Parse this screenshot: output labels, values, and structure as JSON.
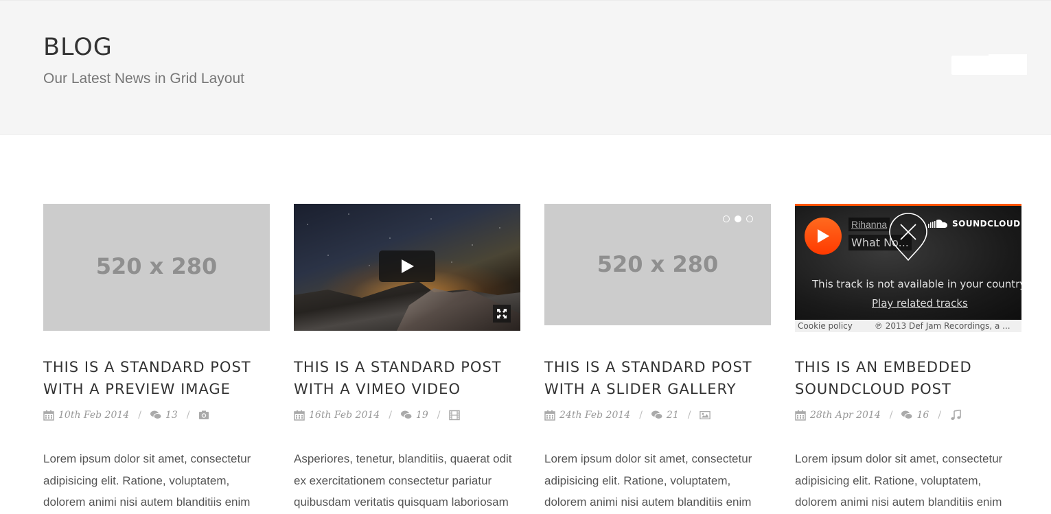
{
  "header": {
    "title": "BLOG",
    "subtitle": "Our Latest News in Grid Layout"
  },
  "posts": [
    {
      "media_type": "image",
      "placeholder": "520 x 280",
      "title_line1": "THIS IS A STANDARD POST",
      "title_line2": "WITH A PREVIEW IMAGE",
      "date": "10th Feb 2014",
      "comments": "13",
      "format_icon": "camera-icon",
      "excerpt": [
        "Lorem ipsum dolor sit amet, consectetur",
        "adipisicing elit. Ratione, voluptatem,",
        "dolorem animi nisi autem blanditiis enim"
      ]
    },
    {
      "media_type": "video",
      "title_line1": "THIS IS A STANDARD POST",
      "title_line2": "WITH A VIMEO VIDEO",
      "date": "16th Feb 2014",
      "comments": "19",
      "format_icon": "film-icon",
      "excerpt": [
        "Asperiores, tenetur, blanditiis, quaerat odit",
        "ex exercitationem consectetur pariatur",
        "quibusdam veritatis quisquam laboriosam"
      ]
    },
    {
      "media_type": "gallery",
      "placeholder": "520 x 280",
      "slides": 3,
      "active_slide": 2,
      "title_line1": "THIS IS A STANDARD POST",
      "title_line2": "WITH A SLIDER GALLERY",
      "date": "24th Feb 2014",
      "comments": "21",
      "format_icon": "picture-icon",
      "excerpt": [
        "Lorem ipsum dolor sit amet, consectetur",
        "adipisicing elit. Ratione, voluptatem,",
        "dolorem animi nisi autem blanditiis enim"
      ]
    },
    {
      "media_type": "audio",
      "title_line1": "THIS IS AN EMBEDDED",
      "title_line2": "SOUNDCLOUD POST",
      "date": "28th Apr 2014",
      "comments": "16",
      "format_icon": "music-icon",
      "excerpt": [
        "Lorem ipsum dolor sit amet, consectetur",
        "adipisicing elit. Ratione, voluptatem,",
        "dolorem animi nisi autem blanditiis enim"
      ]
    }
  ],
  "soundcloud": {
    "artist": "Rihanna",
    "track": "What No...",
    "logo_text": "SOUNDCLOUD",
    "message": "This track is not available in your country.",
    "related_link": "Play related tracks",
    "cookie_policy": "Cookie policy",
    "copyright": "℗ 2013 Def Jam Recordings, a ..."
  },
  "colors": {
    "header_bg": "#f5f5f5",
    "placeholder_bg": "#cccccc",
    "soundcloud_orange": "#ff5500",
    "meta_text": "#999999"
  }
}
